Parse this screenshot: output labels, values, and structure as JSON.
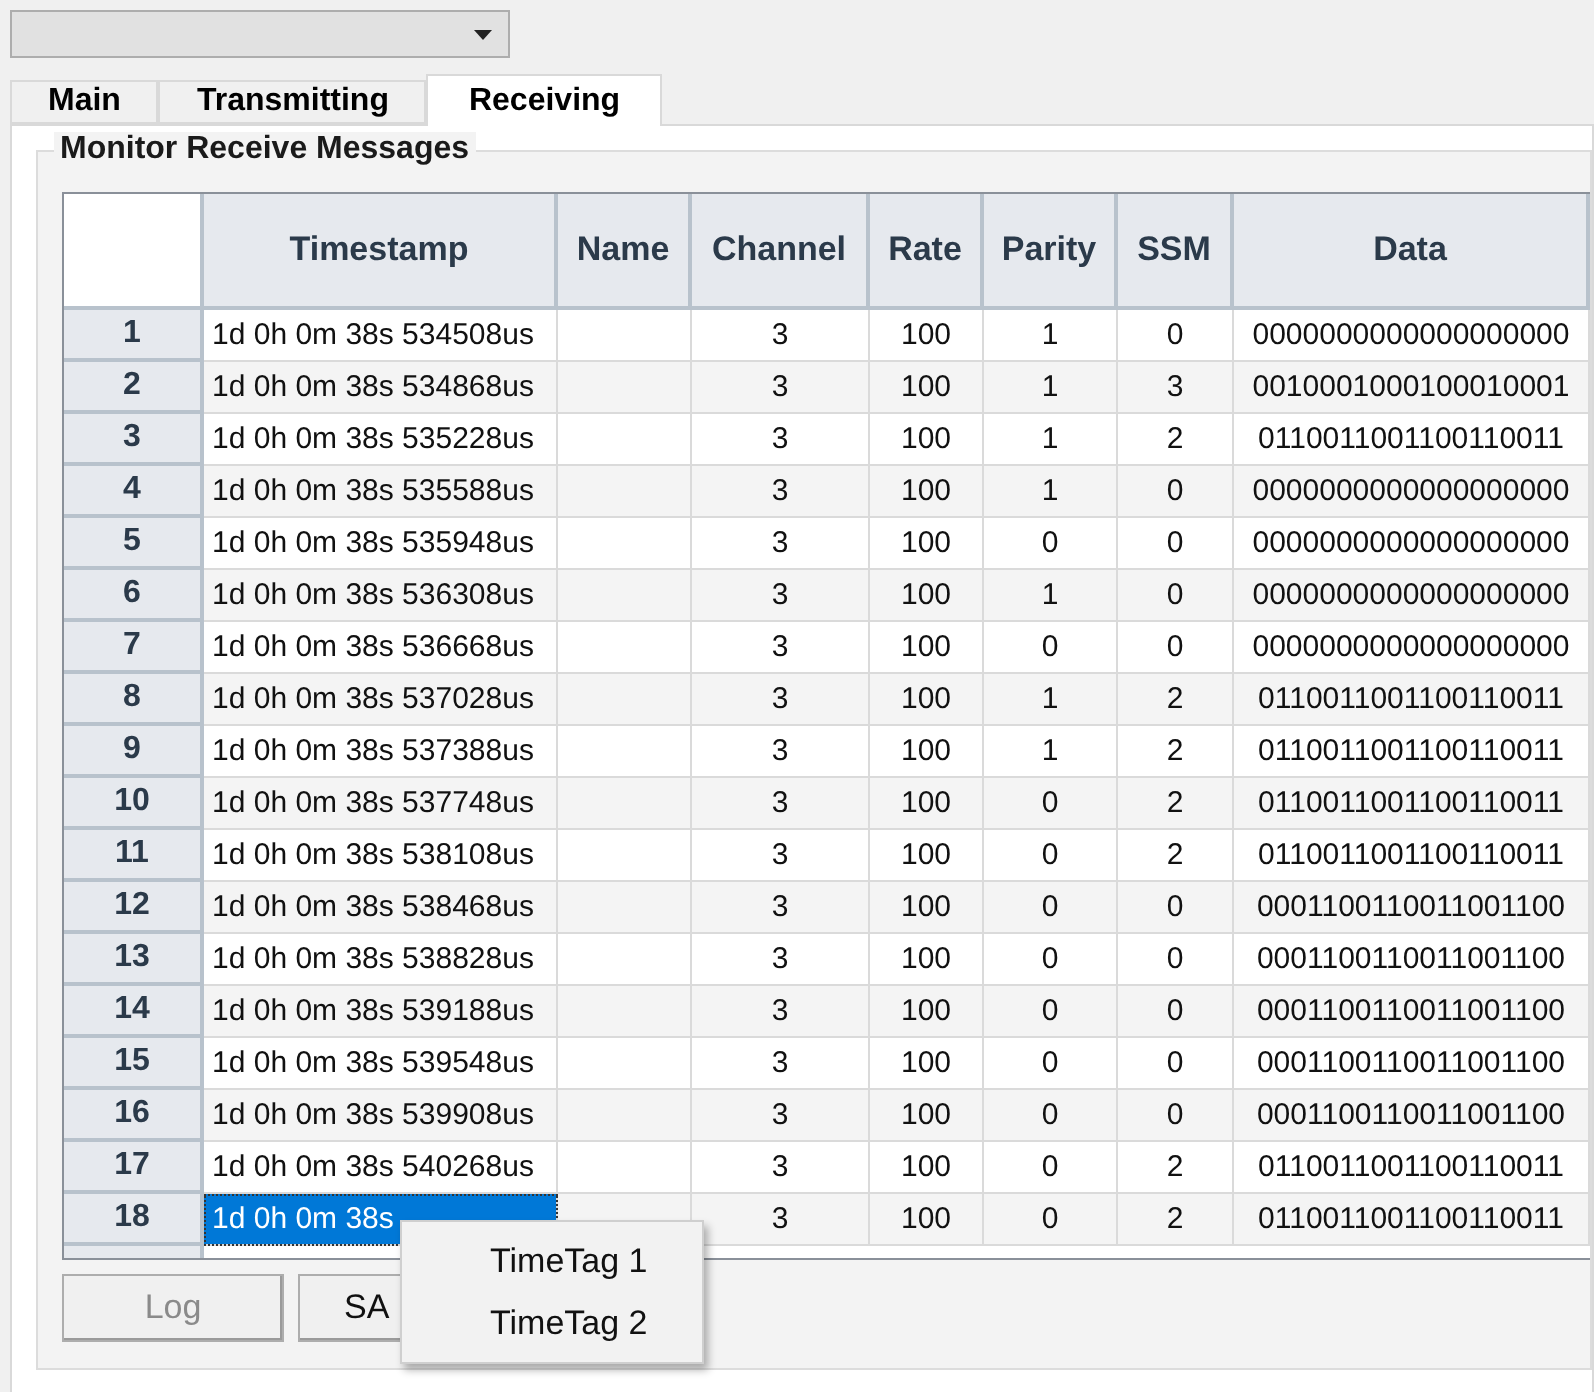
{
  "tabs": [
    {
      "label": "Main",
      "selected": false
    },
    {
      "label": "Transmitting",
      "selected": false
    },
    {
      "label": "Receiving",
      "selected": true
    }
  ],
  "group": {
    "title": "Monitor Receive Messages"
  },
  "table": {
    "columns": [
      "Timestamp",
      "Name",
      "Channel",
      "Rate",
      "Parity",
      "SSM",
      "Data"
    ],
    "rows": [
      {
        "index": "1",
        "timestamp": "1d 0h 0m 38s 534508us",
        "channel": "3",
        "rate": "100",
        "parity": "1",
        "ssm": "0",
        "data": "0000000000000000000",
        "selected": false
      },
      {
        "index": "2",
        "timestamp": "1d 0h 0m 38s 534868us",
        "channel": "3",
        "rate": "100",
        "parity": "1",
        "ssm": "3",
        "data": "0010001000100010001",
        "selected": false
      },
      {
        "index": "3",
        "timestamp": "1d 0h 0m 38s 535228us",
        "channel": "3",
        "rate": "100",
        "parity": "1",
        "ssm": "2",
        "data": "0110011001100110011",
        "selected": false
      },
      {
        "index": "4",
        "timestamp": "1d 0h 0m 38s 535588us",
        "channel": "3",
        "rate": "100",
        "parity": "1",
        "ssm": "0",
        "data": "0000000000000000000",
        "selected": false
      },
      {
        "index": "5",
        "timestamp": "1d 0h 0m 38s 535948us",
        "channel": "3",
        "rate": "100",
        "parity": "0",
        "ssm": "0",
        "data": "0000000000000000000",
        "selected": false
      },
      {
        "index": "6",
        "timestamp": "1d 0h 0m 38s 536308us",
        "channel": "3",
        "rate": "100",
        "parity": "1",
        "ssm": "0",
        "data": "0000000000000000000",
        "selected": false
      },
      {
        "index": "7",
        "timestamp": "1d 0h 0m 38s 536668us",
        "channel": "3",
        "rate": "100",
        "parity": "0",
        "ssm": "0",
        "data": "0000000000000000000",
        "selected": false
      },
      {
        "index": "8",
        "timestamp": "1d 0h 0m 38s 537028us",
        "channel": "3",
        "rate": "100",
        "parity": "1",
        "ssm": "2",
        "data": "0110011001100110011",
        "selected": false
      },
      {
        "index": "9",
        "timestamp": "1d 0h 0m 38s 537388us",
        "channel": "3",
        "rate": "100",
        "parity": "1",
        "ssm": "2",
        "data": "0110011001100110011",
        "selected": false
      },
      {
        "index": "10",
        "timestamp": "1d 0h 0m 38s 537748us",
        "channel": "3",
        "rate": "100",
        "parity": "0",
        "ssm": "2",
        "data": "0110011001100110011",
        "selected": false
      },
      {
        "index": "11",
        "timestamp": "1d 0h 0m 38s 538108us",
        "channel": "3",
        "rate": "100",
        "parity": "0",
        "ssm": "2",
        "data": "0110011001100110011",
        "selected": false
      },
      {
        "index": "12",
        "timestamp": "1d 0h 0m 38s 538468us",
        "channel": "3",
        "rate": "100",
        "parity": "0",
        "ssm": "0",
        "data": "0001100110011001100",
        "selected": false
      },
      {
        "index": "13",
        "timestamp": "1d 0h 0m 38s 538828us",
        "channel": "3",
        "rate": "100",
        "parity": "0",
        "ssm": "0",
        "data": "0001100110011001100",
        "selected": false
      },
      {
        "index": "14",
        "timestamp": "1d 0h 0m 38s 539188us",
        "channel": "3",
        "rate": "100",
        "parity": "0",
        "ssm": "0",
        "data": "0001100110011001100",
        "selected": false
      },
      {
        "index": "15",
        "timestamp": "1d 0h 0m 38s 539548us",
        "channel": "3",
        "rate": "100",
        "parity": "0",
        "ssm": "0",
        "data": "0001100110011001100",
        "selected": false
      },
      {
        "index": "16",
        "timestamp": "1d 0h 0m 38s 539908us",
        "channel": "3",
        "rate": "100",
        "parity": "0",
        "ssm": "0",
        "data": "0001100110011001100",
        "selected": false
      },
      {
        "index": "17",
        "timestamp": "1d 0h 0m 38s 540268us",
        "channel": "3",
        "rate": "100",
        "parity": "0",
        "ssm": "2",
        "data": "0110011001100110011",
        "selected": false
      },
      {
        "index": "18",
        "timestamp": "1d 0h 0m 38s",
        "channel": "3",
        "rate": "100",
        "parity": "0",
        "ssm": "2",
        "data": "0110011001100110011",
        "selected": true
      }
    ]
  },
  "buttons": [
    {
      "label": "Log",
      "disabled": true
    },
    {
      "label": "SA",
      "disabled": false
    }
  ],
  "context_menu": {
    "items": [
      "TimeTag 1",
      "TimeTag 2"
    ]
  }
}
